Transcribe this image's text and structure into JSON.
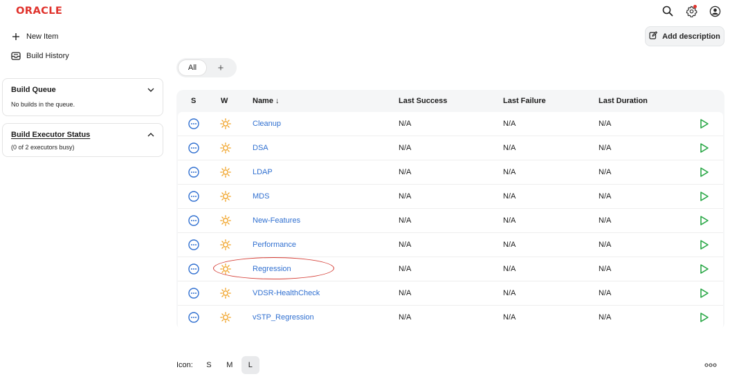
{
  "brand": {
    "logo_text": "ORACLE",
    "color": "#e0332d"
  },
  "header": {
    "icons": [
      "search-icon",
      "settings-icon",
      "user-icon"
    ]
  },
  "sidebar": {
    "new_item": "New Item",
    "build_history": "Build History",
    "build_queue": {
      "title": "Build Queue",
      "body": "No builds in the queue."
    },
    "executor": {
      "title": "Build Executor Status",
      "body": "(0 of 2 executors busy)"
    }
  },
  "actions": {
    "add_description": "Add description"
  },
  "view_tabs": {
    "all": "All",
    "add": "+"
  },
  "table": {
    "headers": {
      "s": "S",
      "w": "W",
      "name": "Name ↓",
      "last_success": "Last Success",
      "last_failure": "Last Failure",
      "last_duration": "Last Duration"
    },
    "rows": [
      {
        "name": "Cleanup",
        "last_success": "N/A",
        "last_failure": "N/A",
        "last_duration": "N/A"
      },
      {
        "name": "DSA",
        "last_success": "N/A",
        "last_failure": "N/A",
        "last_duration": "N/A"
      },
      {
        "name": "LDAP",
        "last_success": "N/A",
        "last_failure": "N/A",
        "last_duration": "N/A"
      },
      {
        "name": "MDS",
        "last_success": "N/A",
        "last_failure": "N/A",
        "last_duration": "N/A"
      },
      {
        "name": "New-Features",
        "last_success": "N/A",
        "last_failure": "N/A",
        "last_duration": "N/A"
      },
      {
        "name": "Performance",
        "last_success": "N/A",
        "last_failure": "N/A",
        "last_duration": "N/A"
      },
      {
        "name": "Regression",
        "last_success": "N/A",
        "last_failure": "N/A",
        "last_duration": "N/A"
      },
      {
        "name": "VDSR-HealthCheck",
        "last_success": "N/A",
        "last_failure": "N/A",
        "last_duration": "N/A"
      },
      {
        "name": "vSTP_Regression",
        "last_success": "N/A",
        "last_failure": "N/A",
        "last_duration": "N/A"
      }
    ]
  },
  "icon_size": {
    "label": "Icon:",
    "options": [
      "S",
      "M",
      "L"
    ],
    "selected": "L"
  },
  "colors": {
    "link": "#2f6fd0",
    "status_blue": "#2f6fd0",
    "weather_sun": "#f0a020",
    "run_green": "#28a745",
    "highlight": "#d43a32"
  }
}
